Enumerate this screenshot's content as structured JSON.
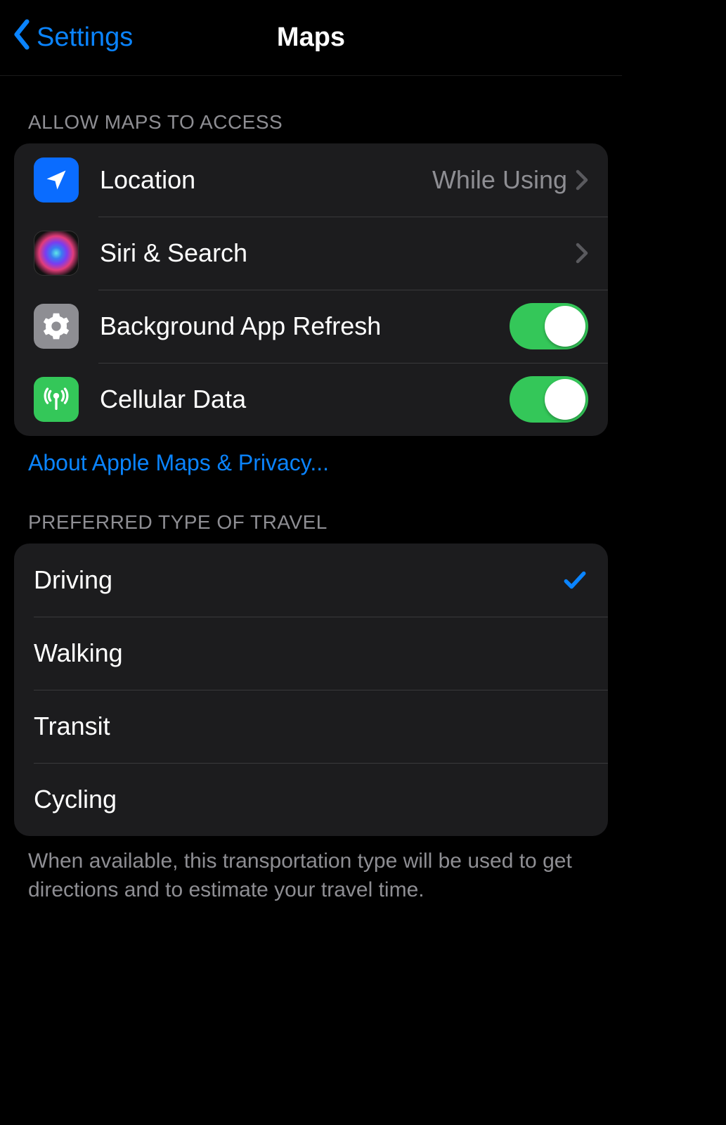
{
  "nav": {
    "back_label": "Settings",
    "title": "Maps"
  },
  "sections": {
    "access": {
      "header": "ALLOW MAPS TO ACCESS",
      "footer_link": "About Apple Maps & Privacy...",
      "rows": {
        "location": {
          "label": "Location",
          "value": "While Using"
        },
        "siri": {
          "label": "Siri & Search"
        },
        "bg_refresh": {
          "label": "Background App Refresh",
          "toggle": true
        },
        "cellular": {
          "label": "Cellular Data",
          "toggle": true
        }
      }
    },
    "travel": {
      "header": "PREFERRED TYPE OF TRAVEL",
      "footer": "When available, this transportation type will be used to get directions and to estimate your travel time.",
      "options": {
        "driving": {
          "label": "Driving",
          "selected": true
        },
        "walking": {
          "label": "Walking",
          "selected": false
        },
        "transit": {
          "label": "Transit",
          "selected": false
        },
        "cycling": {
          "label": "Cycling",
          "selected": false
        }
      }
    }
  }
}
